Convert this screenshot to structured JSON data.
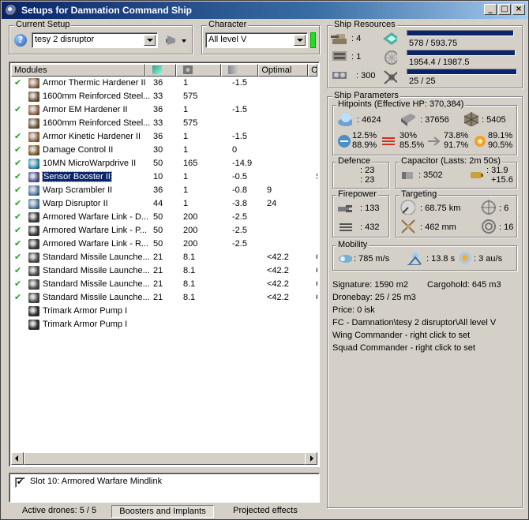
{
  "window": {
    "title": "Setups for Damnation Command Ship"
  },
  "current_setup": {
    "label": "Current Setup",
    "value": "tesy 2 disruptor"
  },
  "character": {
    "label": "Character",
    "value": "All level V"
  },
  "modules": {
    "columns": [
      "Modules",
      "",
      "",
      "",
      "Optimal",
      "O"
    ],
    "rows": [
      {
        "name": "Armor Thermic Hardener II",
        "c1": "36",
        "c2": "1",
        "c3": "-1.5",
        "c4": "",
        "c5": "",
        "check": true,
        "icon": "armor-hardener-icon",
        "color": "#a07050"
      },
      {
        "name": "1600mm Reinforced Steel...",
        "c1": "33",
        "c2": "575",
        "c3": "",
        "c4": "",
        "c5": "",
        "check": false,
        "icon": "armor-plate-icon",
        "color": "#7a6040"
      },
      {
        "name": "Armor EM Hardener II",
        "c1": "36",
        "c2": "1",
        "c3": "-1.5",
        "c4": "",
        "c5": "",
        "check": true,
        "icon": "armor-hardener-icon",
        "color": "#a07050"
      },
      {
        "name": "1600mm Reinforced Steel...",
        "c1": "33",
        "c2": "575",
        "c3": "",
        "c4": "",
        "c5": "",
        "check": false,
        "icon": "armor-plate-icon",
        "color": "#7a6040"
      },
      {
        "name": "Armor Kinetic Hardener II",
        "c1": "36",
        "c2": "1",
        "c3": "-1.5",
        "c4": "",
        "c5": "",
        "check": true,
        "icon": "armor-hardener-icon",
        "color": "#a07050"
      },
      {
        "name": "Damage Control II",
        "c1": "30",
        "c2": "1",
        "c3": "0",
        "c4": "",
        "c5": "",
        "check": true,
        "icon": "damage-control-icon",
        "color": "#906838"
      },
      {
        "name": "10MN MicroWarpdrive II",
        "c1": "50",
        "c2": "165",
        "c3": "-14.9",
        "c4": "",
        "c5": "",
        "check": true,
        "icon": "microwarpdrive-icon",
        "color": "#3aa0c0"
      },
      {
        "name": "Sensor Booster II",
        "c1": "10",
        "c2": "1",
        "c3": "-0.5",
        "c4": "",
        "c5": "S",
        "check": true,
        "icon": "sensor-booster-icon",
        "color": "#6060a0",
        "selected": true
      },
      {
        "name": "Warp Scrambler II",
        "c1": "36",
        "c2": "1",
        "c3": "-0.8",
        "c4": "9",
        "c5": "",
        "check": true,
        "icon": "warp-scrambler-icon",
        "color": "#5a8ab0"
      },
      {
        "name": "Warp Disruptor II",
        "c1": "44",
        "c2": "1",
        "c3": "-3.8",
        "c4": "24",
        "c5": "",
        "check": true,
        "icon": "warp-disruptor-icon",
        "color": "#5a8ab0"
      },
      {
        "name": "Armored Warfare Link - D...",
        "c1": "50",
        "c2": "200",
        "c3": "-2.5",
        "c4": "",
        "c5": "",
        "check": true,
        "icon": "warfare-link-icon",
        "color": "#404040"
      },
      {
        "name": "Armored Warfare Link - P...",
        "c1": "50",
        "c2": "200",
        "c3": "-2.5",
        "c4": "",
        "c5": "",
        "check": true,
        "icon": "warfare-link-icon",
        "color": "#404040"
      },
      {
        "name": "Armored Warfare Link - R...",
        "c1": "50",
        "c2": "200",
        "c3": "-2.5",
        "c4": "",
        "c5": "",
        "check": true,
        "icon": "warfare-link-icon",
        "color": "#404040"
      },
      {
        "name": "Standard Missile Launche...",
        "c1": "21",
        "c2": "8.1",
        "c3": "",
        "c4": "<42.2",
        "c5": "G",
        "check": true,
        "icon": "missile-launcher-icon",
        "color": "#505050"
      },
      {
        "name": "Standard Missile Launche...",
        "c1": "21",
        "c2": "8.1",
        "c3": "",
        "c4": "<42.2",
        "c5": "G",
        "check": true,
        "icon": "missile-launcher-icon",
        "color": "#505050"
      },
      {
        "name": "Standard Missile Launche...",
        "c1": "21",
        "c2": "8.1",
        "c3": "",
        "c4": "<42.2",
        "c5": "G",
        "check": true,
        "icon": "missile-launcher-icon",
        "color": "#505050"
      },
      {
        "name": "Standard Missile Launche...",
        "c1": "21",
        "c2": "8.1",
        "c3": "",
        "c4": "<42.2",
        "c5": "G",
        "check": true,
        "icon": "missile-launcher-icon",
        "color": "#505050"
      },
      {
        "name": "Trimark Armor Pump I",
        "c1": "",
        "c2": "",
        "c3": "",
        "c4": "",
        "c5": "",
        "check": false,
        "icon": "rig-icon",
        "color": "#303030"
      },
      {
        "name": "Trimark Armor Pump I",
        "c1": "",
        "c2": "",
        "c3": "",
        "c4": "",
        "c5": "",
        "check": false,
        "icon": "rig-icon",
        "color": "#303030"
      }
    ]
  },
  "booster": {
    "label": "Slot 10: Armored Warfare Mindlink",
    "checked": true
  },
  "status": {
    "drones": "Active drones: 5 / 5",
    "boosters": "Boosters and Implants",
    "projected": "Projected effects"
  },
  "resources": {
    "title": "Ship Resources",
    "turret_slots": ": 4",
    "launcher_slots": ": 1",
    "calibration": ": 300",
    "cpu": "578 / 593.75",
    "cpu_fraction": 0.973,
    "powergrid": "1954.4 / 1987.5",
    "powergrid_fraction": 0.983,
    "drone_bandwidth": "25 / 25",
    "drone_fraction": 1.0
  },
  "params": {
    "title": "Ship Parameters",
    "hitpoints": {
      "title": "Hitpoints (Effective HP: 370,384)",
      "shield": ": 4624",
      "armor": ": 37656",
      "structure": ": 5405",
      "em_shield": "12.5%",
      "em_armor": "88.9%",
      "thermal_shield": "30%",
      "thermal_armor": "85.5%",
      "kinetic_shield": "73.8%",
      "kinetic_armor": "91.7%",
      "explosive_shield": "89.1%",
      "explosive_armor": "90.5%"
    },
    "defence": {
      "title": "Defence",
      "v1": ": 23",
      "v2": ": 23"
    },
    "capacitor": {
      "title": "Capacitor (Lasts: 2m 50s)",
      "capacity": ": 3502",
      "recharge": ": 31.9",
      "delta": "+15.6"
    },
    "firepower": {
      "title": "Firepower",
      "dps": ": 133",
      "volley": ": 432"
    },
    "targeting": {
      "title": "Targeting",
      "range": ": 68.75 km",
      "targets": ": 6",
      "scan_res": ": 462 mm",
      "sensor": ": 16"
    },
    "mobility": {
      "title": "Mobility",
      "speed": ": 785 m/s",
      "align": ": 13.8 s",
      "warp": ": 3 au/s"
    },
    "signature": "Signature: 1590 m2",
    "cargohold": "Cargohold: 645 m3",
    "dronebay": "Dronebay: 25 / 25 m3",
    "price": "Price: 0 isk",
    "fc": "FC - Damnation\\tesy 2 disruptor\\All level V",
    "wing": "Wing Commander - right click to set",
    "squad": "Squad Commander - right click to set"
  }
}
